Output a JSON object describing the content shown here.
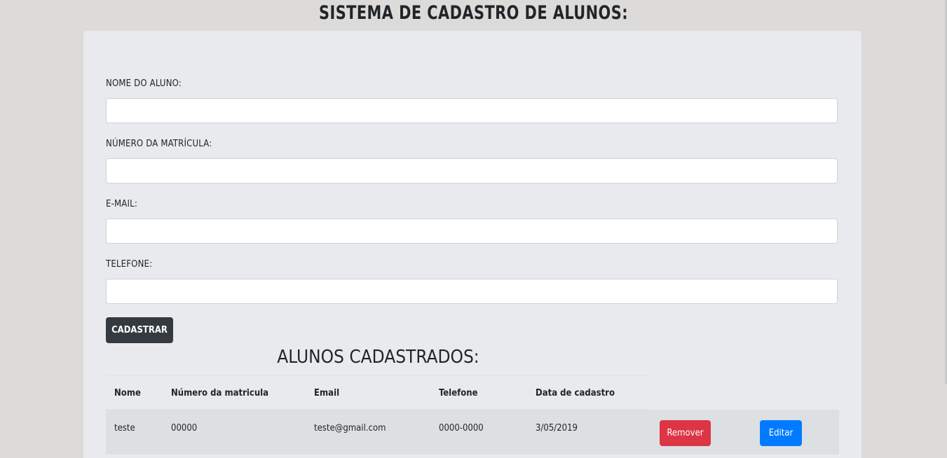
{
  "page": {
    "title": "SISTEMA DE CADASTRO DE ALUNOS:"
  },
  "form": {
    "fields": [
      {
        "label": "NOME DO ALUNO:",
        "value": "",
        "placeholder": ""
      },
      {
        "label": "NÚMERO DA MATRÍCULA:",
        "value": "",
        "placeholder": ""
      },
      {
        "label": "E-MAIL:",
        "value": "",
        "placeholder": ""
      },
      {
        "label": "TELEFONE:",
        "value": "",
        "placeholder": ""
      }
    ],
    "submit_label": "CADASTRAR"
  },
  "table": {
    "title": "ALUNOS CADASTRADOS:",
    "columns": [
      "Nome",
      "Número da matricula",
      "Email",
      "Telefone",
      "Data de cadastro"
    ],
    "rows": [
      {
        "nome": "teste",
        "matricula": "00000",
        "email": "teste@gmail.com",
        "telefone": "0000-0000",
        "data": "3/05/2019",
        "remove_label": "Remover",
        "edit_label": "Editar"
      }
    ]
  },
  "colors": {
    "background": "#dcdbda",
    "card": "#e8eaed",
    "dark_button": "#343a40",
    "danger_button": "#dc3545",
    "primary_button": "#007bff",
    "row_highlight": "#dde0e3"
  }
}
